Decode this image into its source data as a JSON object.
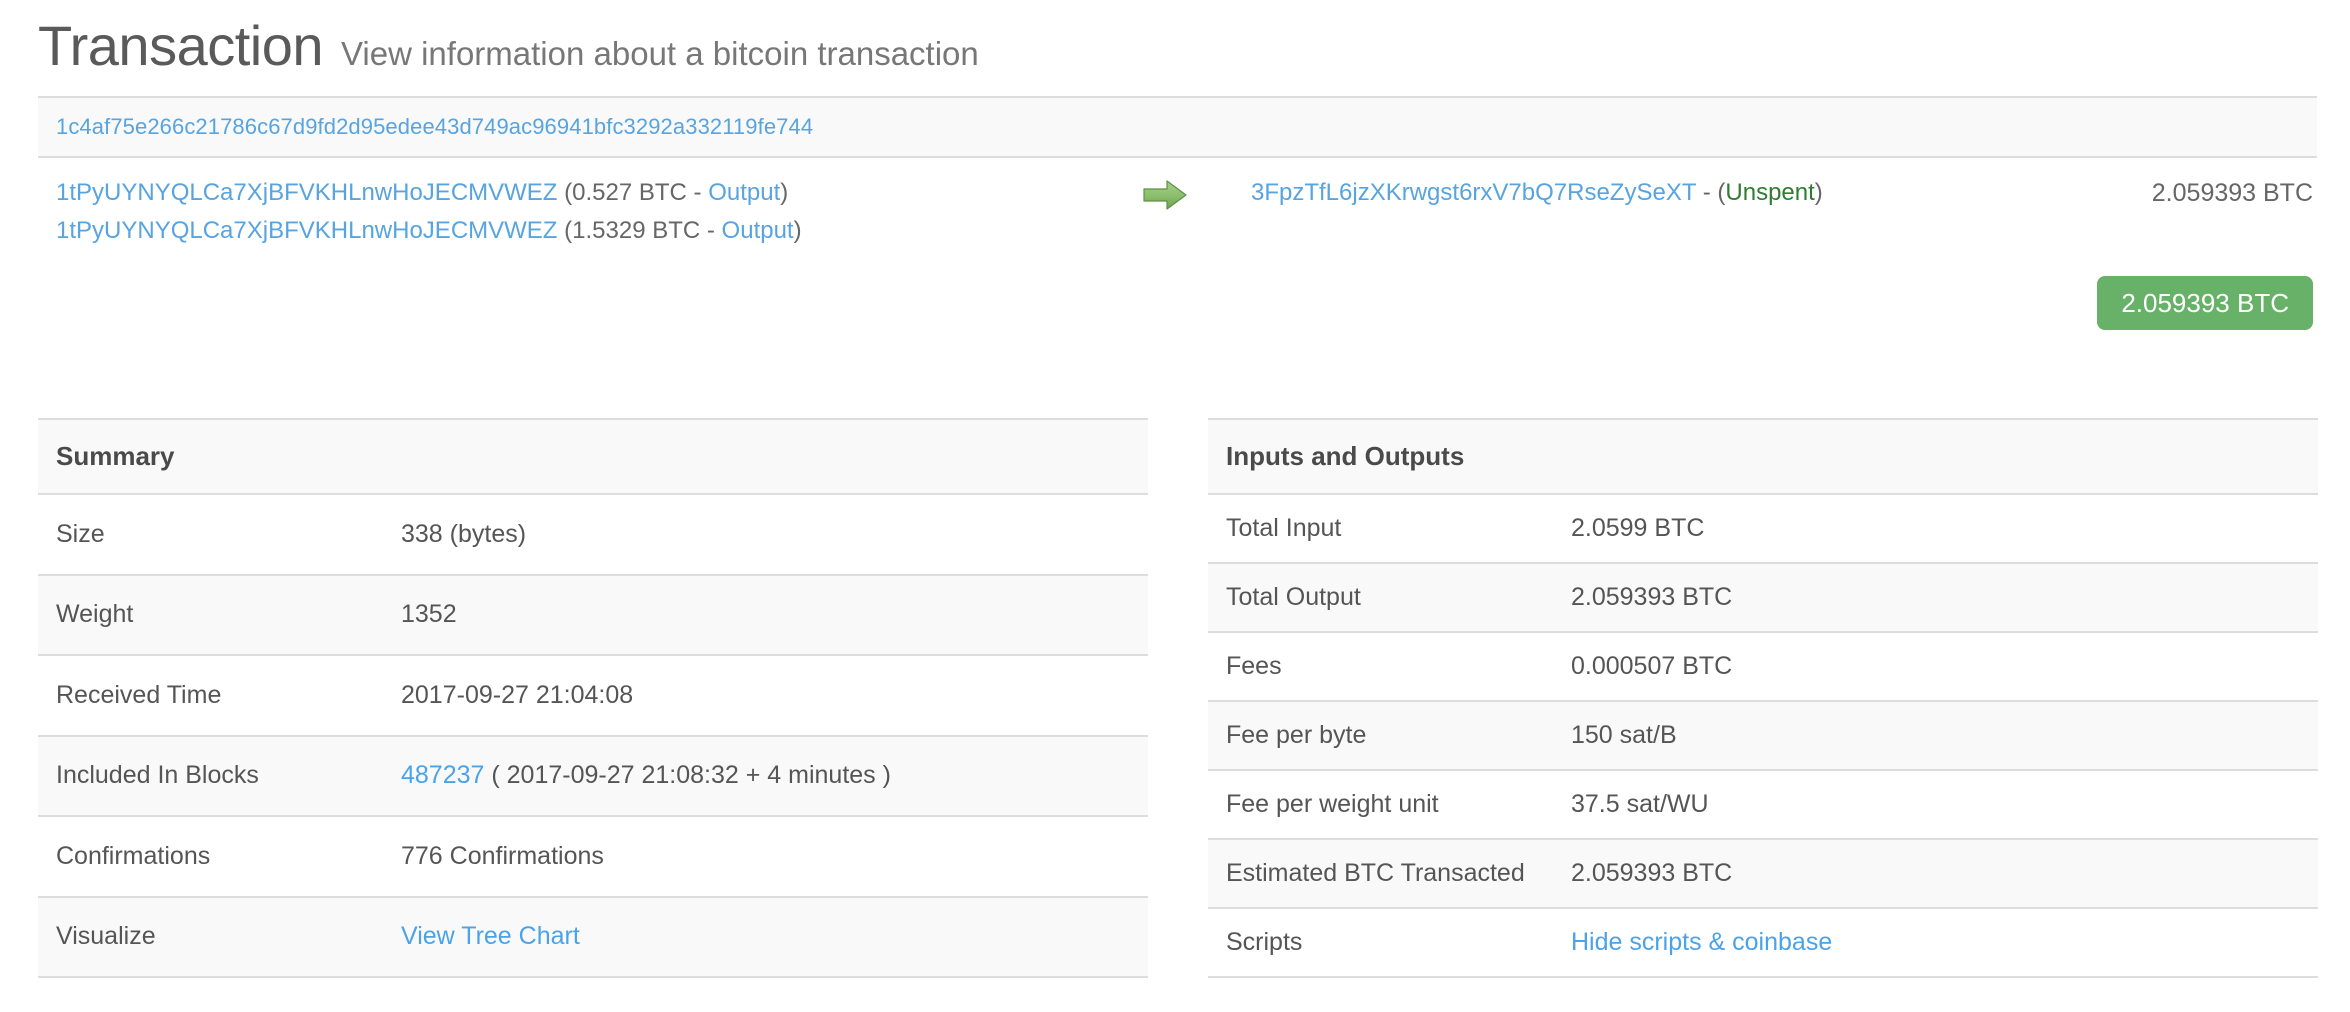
{
  "header": {
    "title": "Transaction",
    "subtitle": "View information about a bitcoin transaction"
  },
  "transaction": {
    "hash": "1c4af75e266c21786c67d9fd2d95edee43d749ac96941bfc3292a332119fe744",
    "arrow_icon": "green-right-arrow-icon",
    "inputs": [
      {
        "address": "1tPyUYNYQLCa7XjBFVKHLnwHoJECMVWEZ",
        "open_paren": "(",
        "amount": "0.527 BTC",
        "dash": " - ",
        "link_label": "Output",
        "close_paren": ")"
      },
      {
        "address": "1tPyUYNYQLCa7XjBFVKHLnwHoJECMVWEZ",
        "open_paren": "(",
        "amount": "1.5329 BTC",
        "dash": " - ",
        "link_label": "Output",
        "close_paren": ")"
      }
    ],
    "outputs": [
      {
        "address": "3FpzTfL6jzXKrwgst6rxV7bQ7RseZySeXT",
        "separator": " - (",
        "status": "Unspent",
        "close_paren": ")",
        "amount": "2.059393 BTC"
      }
    ],
    "total_badge": "2.059393 BTC",
    "badge_color": "#68b168"
  },
  "summary": {
    "heading": "Summary",
    "rows": [
      {
        "label": "Size",
        "value": "338 (bytes)"
      },
      {
        "label": "Weight",
        "value": "1352"
      },
      {
        "label": "Received Time",
        "value": "2017-09-27 21:04:08"
      },
      {
        "label": "Included In Blocks",
        "link": "487237",
        "value": " ( 2017-09-27 21:08:32 + 4 minutes )"
      },
      {
        "label": "Confirmations",
        "value": "776 Confirmations"
      },
      {
        "label": "Visualize",
        "link": "View Tree Chart",
        "value": ""
      }
    ]
  },
  "inputs_outputs": {
    "heading": "Inputs and Outputs",
    "rows": [
      {
        "label": "Total Input",
        "value": "2.0599 BTC"
      },
      {
        "label": "Total Output",
        "value": "2.059393 BTC"
      },
      {
        "label": "Fees",
        "value": "0.000507 BTC"
      },
      {
        "label": "Fee per byte",
        "value": "150 sat/B"
      },
      {
        "label": "Fee per weight unit",
        "value": "37.5 sat/WU"
      },
      {
        "label": "Estimated BTC Transacted",
        "value": "2.059393 BTC"
      },
      {
        "label": "Scripts",
        "link": "Hide scripts & coinbase",
        "value": ""
      }
    ]
  },
  "colors": {
    "link": "#4aa3e8",
    "text": "#555555",
    "unspent": "#2e7d32",
    "row_stripe": "#f9f9f9",
    "border": "#dddddd"
  }
}
